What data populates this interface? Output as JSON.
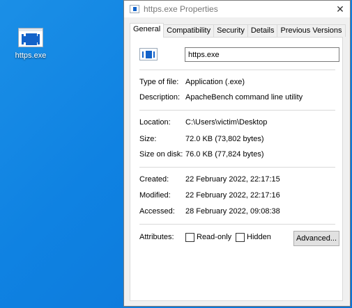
{
  "desktop": {
    "icon_label": "https.exe"
  },
  "window": {
    "title": "https.exe Properties",
    "close_glyph": "✕",
    "tabs": [
      {
        "label": "General",
        "active": true
      },
      {
        "label": "Compatibility"
      },
      {
        "label": "Security"
      },
      {
        "label": "Details"
      },
      {
        "label": "Previous Versions"
      }
    ],
    "general": {
      "file_name": "https.exe",
      "type_label": "Type of file:",
      "type_value": "Application (.exe)",
      "description_label": "Description:",
      "description_value": "ApacheBench command line utility",
      "location_label": "Location:",
      "location_value": "C:\\Users\\victim\\Desktop",
      "size_label": "Size:",
      "size_value": "72.0 KB (73,802 bytes)",
      "size_on_disk_label": "Size on disk:",
      "size_on_disk_value": "76.0 KB (77,824 bytes)",
      "created_label": "Created:",
      "created_value": "22 February 2022, 22:17:15",
      "modified_label": "Modified:",
      "modified_value": "22 February 2022, 22:17:16",
      "accessed_label": "Accessed:",
      "accessed_value": "28 February 2022, 09:08:38",
      "attributes_label": "Attributes:",
      "readonly_label": "Read-only",
      "hidden_label": "Hidden",
      "advanced_label": "Advanced..."
    }
  },
  "colors": {
    "desktop_blue": "#0f82e2",
    "icon_blue": "#1262c9"
  }
}
